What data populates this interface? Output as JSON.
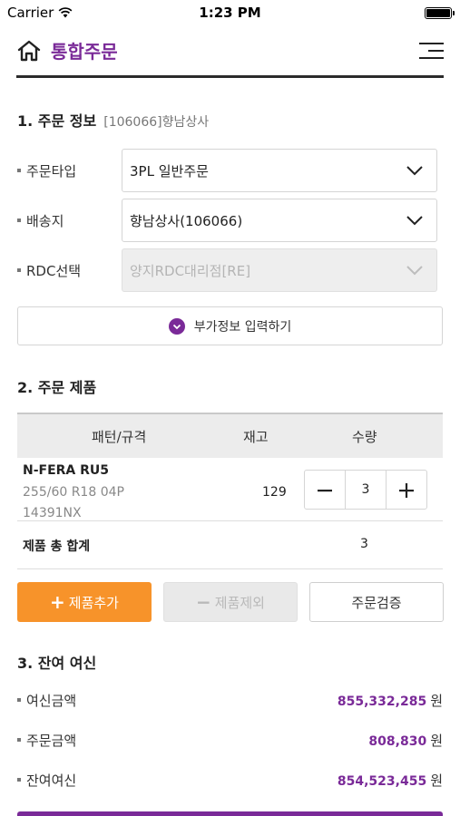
{
  "status_bar": {
    "carrier": "Carrier",
    "time": "1:23 PM"
  },
  "header": {
    "title": "통합주문"
  },
  "order_info": {
    "title": "1. 주문 정보",
    "code": "[106066]향남상사",
    "fields": [
      {
        "label": "주문타입",
        "value": "3PL 일반주문"
      },
      {
        "label": "배송지",
        "value": "향남상사(106066)"
      },
      {
        "label": "RDC선택",
        "value": "양지RDC대리점[RE]"
      }
    ],
    "extra_label": "부가정보 입력하기"
  },
  "products": {
    "title": "2. 주문 제품",
    "columns": [
      "패턴/규격",
      "재고",
      "수량"
    ],
    "rows": [
      {
        "name": "N-FERA RU5",
        "spec": "255/60 R18 04P",
        "code": "14391NX",
        "stock": "129",
        "qty": "3"
      }
    ],
    "total_label": "제품 총 합계",
    "total_value": "3",
    "add_label": "제품추가",
    "remove_label": "제품제외",
    "verify_label": "주문검증"
  },
  "credit": {
    "title": "3. 잔여 여신",
    "unit": "원",
    "items": [
      {
        "label": "여신금액",
        "value": "855,332,285"
      },
      {
        "label": "주문금액",
        "value": "808,830"
      },
      {
        "label": "잔여여신",
        "value": "854,523,455"
      }
    ]
  },
  "colors": {
    "brand": "#7a2a98",
    "accent_orange": "#f7932a"
  }
}
